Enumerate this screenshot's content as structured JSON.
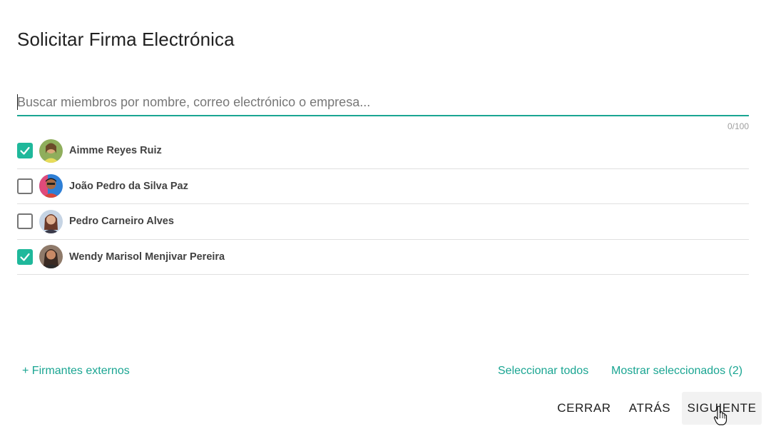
{
  "dialog": {
    "title": "Solicitar Firma Electrónica"
  },
  "search": {
    "placeholder": "Buscar miembros por nombre, correo electrónico o empresa...",
    "value": "",
    "counter": "0/100"
  },
  "members": [
    {
      "name": "Aimme Reyes Ruiz",
      "checked": true,
      "avatar_colors": [
        "#c9b25a",
        "#7a9a3a"
      ]
    },
    {
      "name": "João Pedro da Silva Paz",
      "checked": false,
      "avatar_colors": [
        "#2e7fd6",
        "#d9473a"
      ]
    },
    {
      "name": "Pedro Carneiro Alves",
      "checked": false,
      "avatar_colors": [
        "#c6d4e4",
        "#6b3a2a"
      ]
    },
    {
      "name": "Wendy Marisol Menjivar Pereira",
      "checked": true,
      "avatar_colors": [
        "#8f7a6a",
        "#3a2a22"
      ]
    }
  ],
  "links": {
    "external_signers": "+ Firmantes externos",
    "select_all": "Seleccionar todos",
    "show_selected": "Mostrar seleccionados (2)"
  },
  "actions": {
    "close": "CERRAR",
    "back": "ATRÁS",
    "next": "SIGUIENTE"
  },
  "colors": {
    "accent": "#1aa592",
    "checkbox_checked": "#1fb89b"
  }
}
